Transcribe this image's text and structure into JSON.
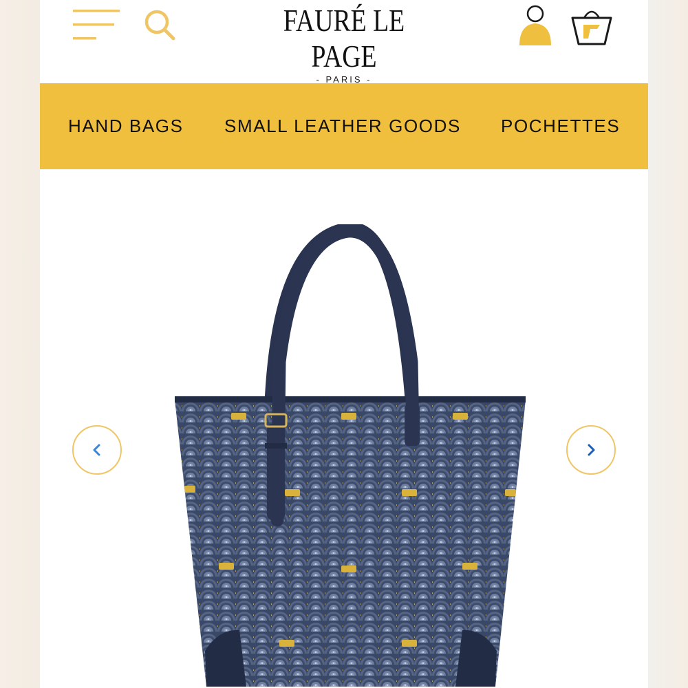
{
  "brand": {
    "name": "FAURÉ LE PAGE",
    "tagline": "- PARIS -"
  },
  "nav": {
    "items": [
      {
        "label": "HAND BAGS"
      },
      {
        "label": "SMALL LEATHER GOODS"
      },
      {
        "label": "POCHETTES"
      }
    ]
  },
  "icons": {
    "menu": "menu-icon",
    "search": "search-icon",
    "account": "account-icon",
    "cart": "shopping-basket-icon",
    "prev": "chevron-left-icon",
    "next": "chevron-right-icon"
  },
  "colors": {
    "accent": "#f0bf3e",
    "arrow": "#3a86d6",
    "bag": "#3c4a6e"
  }
}
